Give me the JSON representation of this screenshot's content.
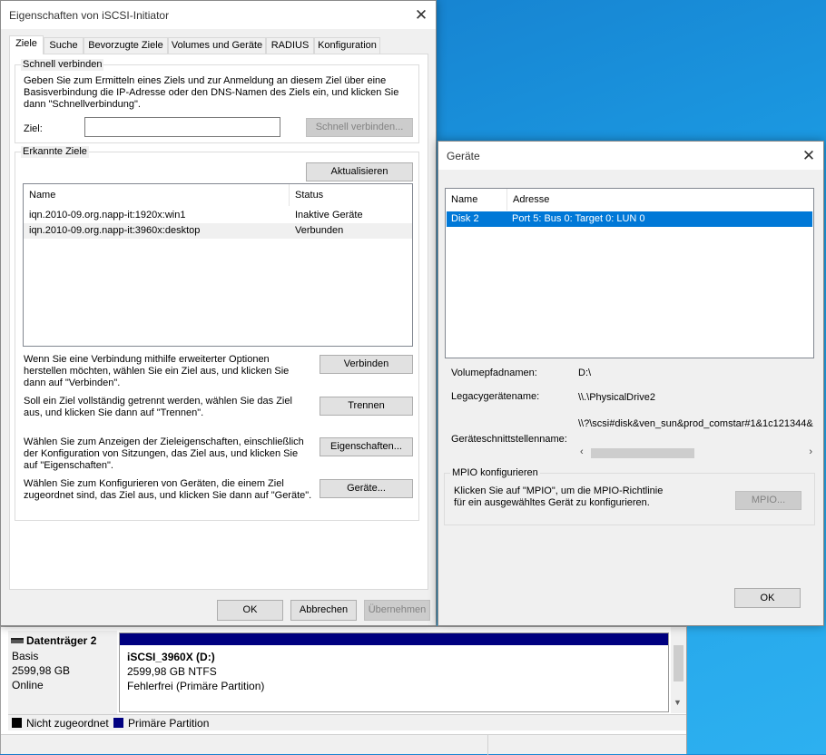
{
  "initiator": {
    "title": "Eigenschaften von iSCSI-Initiator",
    "tabs": [
      "Ziele",
      "Suche",
      "Bevorzugte Ziele",
      "Volumes und Geräte",
      "RADIUS",
      "Konfiguration"
    ],
    "quick": {
      "group": "Schnell verbinden",
      "desc1": "Geben Sie zum Ermitteln eines Ziels und zur Anmeldung an diesem Ziel über eine",
      "desc2": "Basisverbindung die IP-Adresse oder den DNS-Namen des Ziels ein, und klicken Sie",
      "desc3": "dann \"Schnellverbindung\".",
      "label": "Ziel:",
      "value": "",
      "button": "Schnell verbinden..."
    },
    "found": {
      "group": "Erkannte Ziele",
      "refresh": "Aktualisieren",
      "col_name": "Name",
      "col_status": "Status",
      "rows": [
        {
          "name": "iqn.2010-09.org.napp-it:1920x:win1",
          "status": "Inaktive Geräte"
        },
        {
          "name": "iqn.2010-09.org.napp-it:3960x:desktop",
          "status": "Verbunden"
        }
      ]
    },
    "actions": {
      "connect_t1": "Wenn Sie eine Verbindung mithilfe erweiterter Optionen",
      "connect_t2": "herstellen möchten, wählen Sie ein Ziel aus, und klicken Sie",
      "connect_t3": "dann auf \"Verbinden\".",
      "connect_btn": "Verbinden",
      "disconnect_t1": "Soll ein Ziel vollständig getrennt werden, wählen Sie das Ziel",
      "disconnect_t2": "aus, und klicken Sie dann auf \"Trennen\".",
      "disconnect_btn": "Trennen",
      "props_t1": "Wählen Sie zum Anzeigen der Zieleigenschaften, einschließlich",
      "props_t2": "der Konfiguration von Sitzungen, das Ziel aus, und klicken Sie",
      "props_t3": "auf \"Eigenschaften\".",
      "props_btn": "Eigenschaften...",
      "devices_t1": "Wählen Sie zum Konfigurieren von Geräten, die einem Ziel",
      "devices_t2": "zugeordnet sind, das Ziel aus, und klicken Sie dann auf \"Geräte\".",
      "devices_btn": "Geräte..."
    },
    "footer": {
      "ok": "OK",
      "cancel": "Abbrechen",
      "apply": "Übernehmen"
    }
  },
  "devices": {
    "title": "Geräte",
    "col_name": "Name",
    "col_addr": "Adresse",
    "rows": [
      {
        "name": "Disk 2",
        "addr": "Port 5: Bus 0: Target 0: LUN 0"
      }
    ],
    "vol_label": "Volumepfadnamen:",
    "vol_value": "D:\\",
    "legacy_label": "Legacygerätename:",
    "legacy_value": "\\\\.\\PhysicalDrive2",
    "iface_label": "Geräteschnittstellenname:",
    "iface_value": "\\\\?\\scsi#disk&ven_sun&prod_comstar#1&1c121344&",
    "mpio_group": "MPIO konfigurieren",
    "mpio_t1": "Klicken Sie auf \"MPIO\", um die MPIO-Richtlinie",
    "mpio_t2": "für ein ausgewähltes Gerät zu konfigurieren.",
    "mpio_btn": "MPIO...",
    "ok": "OK"
  },
  "diskmgmt": {
    "disk_name": "Datenträger 2",
    "disk_type": "Basis",
    "disk_size": "2599,98 GB",
    "disk_state": "Online",
    "vol_name": "iSCSI_3960X  (D:)",
    "vol_size": "2599,98 GB NTFS",
    "vol_health": "Fehlerfrei (Primäre Partition)",
    "legend_unalloc": "Nicht zugeordnet",
    "legend_primary": "Primäre Partition"
  },
  "colors": {
    "selection": "#0078d7",
    "primary_partition": "#000080",
    "desktop": "#1a8fdc"
  }
}
